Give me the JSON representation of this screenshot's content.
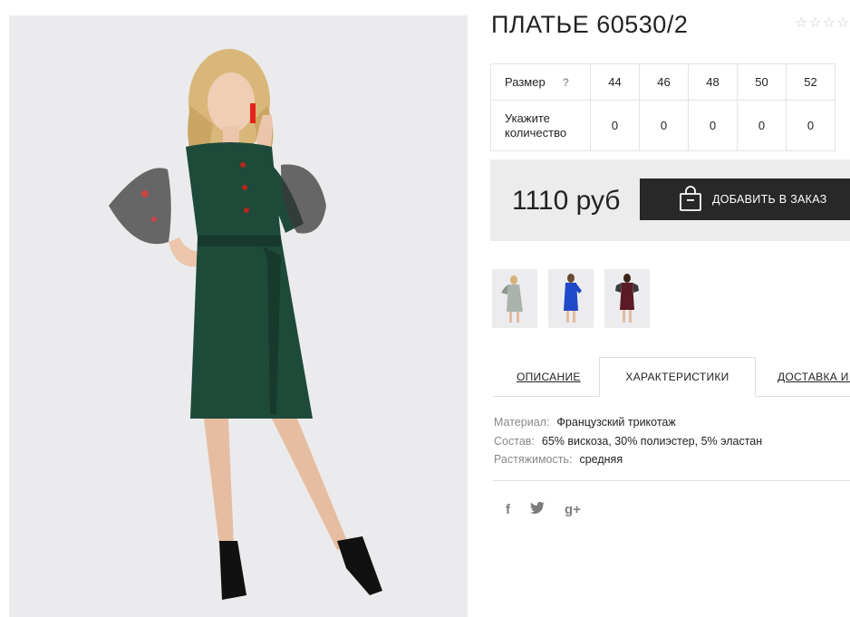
{
  "product": {
    "title": "ПЛАТЬЕ 60530/2",
    "rating_stars": [
      "☆",
      "☆",
      "☆",
      "☆"
    ]
  },
  "size_table": {
    "size_label": "Размер",
    "help_icon": "?",
    "sizes": [
      "44",
      "46",
      "48",
      "50",
      "52"
    ],
    "qty_label": "Укажите количество",
    "quantities": [
      "0",
      "0",
      "0",
      "0",
      "0"
    ]
  },
  "purchase": {
    "price": "1110 руб",
    "add_button_label": "ДОБАВИТЬ В ЗАКАЗ",
    "icon": "shopping-bag-icon"
  },
  "colors": {
    "dress_green": "#1e4a3a",
    "dress_blue": "#1f49c8",
    "dress_burgundy": "#5a1a26",
    "dress_grey": "#a9b3ab",
    "button_bg": "#282828",
    "price_bg": "#ececec"
  },
  "thumbnails": [
    {
      "variant": "grey"
    },
    {
      "variant": "blue"
    },
    {
      "variant": "burgundy"
    }
  ],
  "tabs": [
    "ОПИСАНИЕ",
    "ХАРАКТЕРИСТИКИ",
    "ДОСТАВКА И ОПЛАТА"
  ],
  "active_tab": "ХАРАКТЕРИСТИКИ",
  "specs": [
    {
      "label": "Материал:",
      "value": "Французский трикотаж"
    },
    {
      "label": "Состав:",
      "value": "65% вискоза, 30% полиэстер, 5% эластан"
    },
    {
      "label": "Растяжимость:",
      "value": "средняя"
    }
  ],
  "social": {
    "facebook": "f",
    "twitter": "twitter-icon",
    "googleplus": "g+"
  }
}
